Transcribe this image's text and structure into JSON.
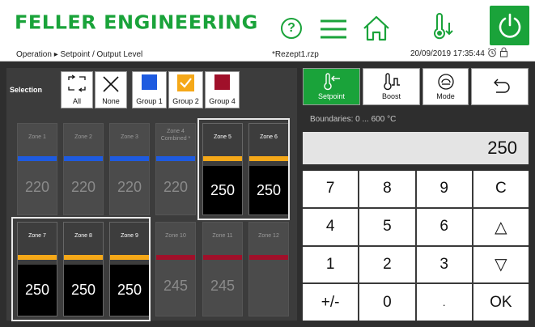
{
  "header": {
    "brand": "FELLER ENGINEERING",
    "breadcrumb": "Operation ▸ Setpoint / Output Level",
    "file": "*Rezept1.rzp",
    "datetime": "20/09/2019 17:35:44",
    "icons": {
      "help": "help-icon",
      "menu": "menu-icon",
      "home": "home-icon",
      "thermo": "thermometer-down-icon",
      "power": "power-icon",
      "clock": "alarm-clock-icon",
      "lock": "lock-icon"
    }
  },
  "colors": {
    "accent": "#1aa33a",
    "blue": "#1e5be0",
    "orange": "#f5a818",
    "red": "#a0102a"
  },
  "selection": {
    "label": "Selection",
    "buttons": [
      {
        "label": "All",
        "icon": "select-all-icon"
      },
      {
        "label": "None",
        "icon": "x-icon"
      },
      {
        "label": "Group 1",
        "icon": "blue-square"
      },
      {
        "label": "Group 2",
        "icon": "orange-check"
      },
      {
        "label": "Group 4",
        "icon": "red-square"
      }
    ]
  },
  "zones": [
    {
      "label": "Zone 1",
      "value": "220",
      "bar": "blue",
      "active": false
    },
    {
      "label": "Zone 2",
      "value": "220",
      "bar": "blue",
      "active": false
    },
    {
      "label": "Zone 3",
      "value": "220",
      "bar": "blue",
      "active": false
    },
    {
      "label": "Zone 4\nCombined *",
      "value": "220",
      "bar": "blue",
      "active": false
    },
    {
      "label": "Zone 5",
      "value": "250",
      "bar": "orange",
      "active": true
    },
    {
      "label": "Zone 6",
      "value": "250",
      "bar": "orange",
      "active": true
    },
    {
      "label": "Zone 7",
      "value": "250",
      "bar": "orange",
      "active": true
    },
    {
      "label": "Zone 8",
      "value": "250",
      "bar": "orange",
      "active": true
    },
    {
      "label": "Zone 9",
      "value": "250",
      "bar": "orange",
      "active": true
    },
    {
      "label": "Zone 10",
      "value": "245",
      "bar": "red",
      "active": false
    },
    {
      "label": "Zone 11",
      "value": "245",
      "bar": "red",
      "active": false
    },
    {
      "label": "Zone 12",
      "value": "",
      "bar": "red",
      "active": false
    }
  ],
  "tabs": [
    {
      "label": "Setpoint",
      "icon": "thermometer-left-icon",
      "selected": true
    },
    {
      "label": "Boost",
      "icon": "thermometer-boost-icon",
      "selected": false
    },
    {
      "label": "Mode",
      "icon": "mode-icon",
      "selected": false
    },
    {
      "label": "",
      "icon": "back-icon",
      "selected": false
    }
  ],
  "boundaries": "Boundaries: 0 ... 600 °C",
  "display": "250",
  "keypad": [
    "7",
    "8",
    "9",
    "C",
    "4",
    "5",
    "6",
    "△",
    "1",
    "2",
    "3",
    "▽",
    "+/-",
    "0",
    ".",
    "OK"
  ]
}
